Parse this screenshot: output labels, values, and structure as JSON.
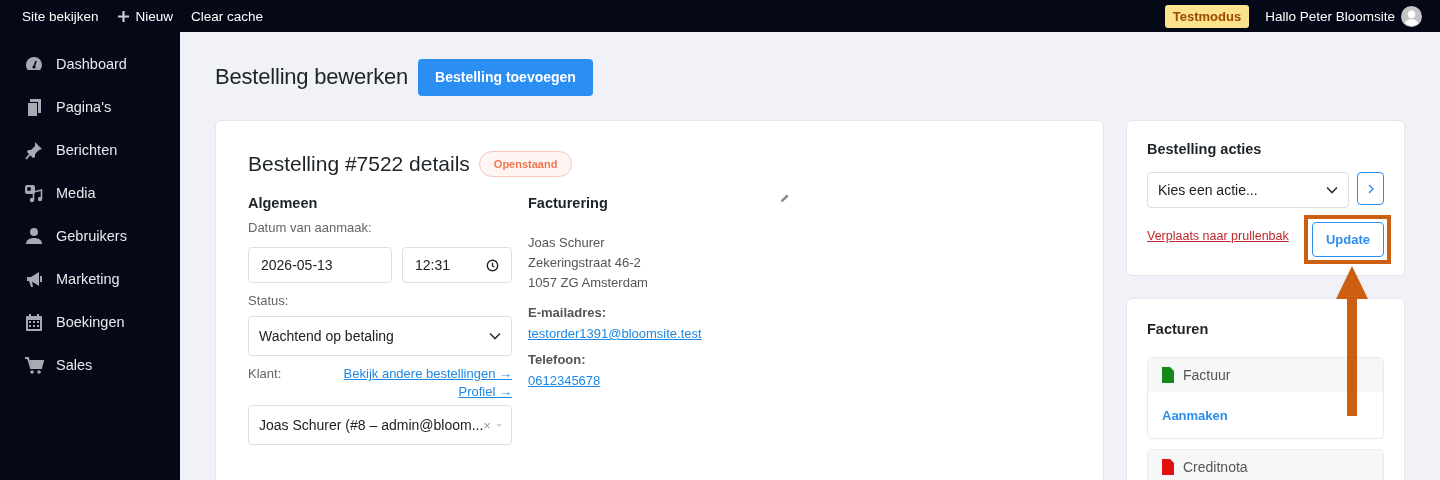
{
  "topbar": {
    "site_link": "Site bekijken",
    "new_button": "Nieuw",
    "clear_cache": "Clear cache",
    "test_badge": "Testmodus",
    "greeting": "Hallo Peter Bloomsite"
  },
  "sidebar": {
    "items": [
      {
        "label": "Dashboard"
      },
      {
        "label": "Pagina's"
      },
      {
        "label": "Berichten"
      },
      {
        "label": "Media"
      },
      {
        "label": "Gebruikers"
      },
      {
        "label": "Marketing"
      },
      {
        "label": "Boekingen"
      },
      {
        "label": "Sales"
      }
    ]
  },
  "page": {
    "title": "Bestelling bewerken",
    "add_button": "Bestelling toevoegen"
  },
  "order": {
    "title": "Bestelling #7522 details",
    "status_badge": "Openstaand",
    "general": {
      "heading": "Algemeen",
      "date_label": "Datum van aanmaak:",
      "date": "2026-05-13",
      "time": "12:31",
      "status_label": "Status:",
      "status": "Wachtend op betaling",
      "customer_label": "Klant:",
      "other_orders_link": "Bekijk andere bestellingen →",
      "profile_link": "Profiel →",
      "customer": "Joas Schurer (#8 – admin@bloom...",
      "clear_mark": "×"
    },
    "billing": {
      "heading": "Facturering",
      "address": [
        "Joas Schurer",
        "Zekeringstraat 46-2",
        "1057 ZG Amsterdam"
      ],
      "email_label": "E-mailadres:",
      "email": "testorder1391@bloomsite.test",
      "phone_label": "Telefoon:",
      "phone": "0612345678"
    }
  },
  "actions": {
    "title": "Bestelling acties",
    "action_select": "Kies een actie...",
    "trash_link": "Verplaats naar prullenbak",
    "update_button": "Update"
  },
  "invoices": {
    "title": "Facturen",
    "documents": [
      {
        "label": "Factuur",
        "color": "#138a17",
        "action": "Aanmaken"
      },
      {
        "label": "Creditnota",
        "color": "#e01010"
      }
    ]
  }
}
